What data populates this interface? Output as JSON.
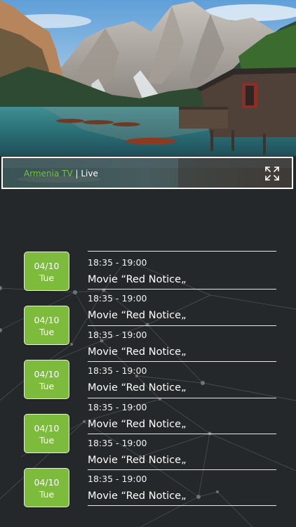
{
  "player": {
    "channel_name": "Armenia TV",
    "separator": " | ",
    "status": "Live"
  },
  "schedule": {
    "days": [
      {
        "date": "04/10",
        "day": "Tue"
      },
      {
        "date": "04/10",
        "day": "Tue"
      },
      {
        "date": "04/10",
        "day": "Tue"
      },
      {
        "date": "04/10",
        "day": "Tue"
      },
      {
        "date": "04/10",
        "day": "Tue"
      }
    ],
    "programs": [
      {
        "time": "18:35 - 19:00",
        "title": "Movie “Red Notice„"
      },
      {
        "time": "18:35 - 19:00",
        "title": "Movie “Red Notice„"
      },
      {
        "time": "18:35 - 19:00",
        "title": "Movie “Red Notice„"
      },
      {
        "time": "18:35 - 19:00",
        "title": "Movie “Red Notice„"
      },
      {
        "time": "18:35 - 19:00",
        "title": "Movie “Red Notice„"
      },
      {
        "time": "18:35 - 19:00",
        "title": "Movie “Red Notice„"
      },
      {
        "time": "18:35 - 19:00",
        "title": "Movie “Red Notice„"
      }
    ]
  },
  "colors": {
    "background": "#25282a",
    "accent_green": "#7dbb3c",
    "channel_text": "#77c043"
  },
  "icons": {
    "fullscreen": "expand-arrows-icon"
  }
}
